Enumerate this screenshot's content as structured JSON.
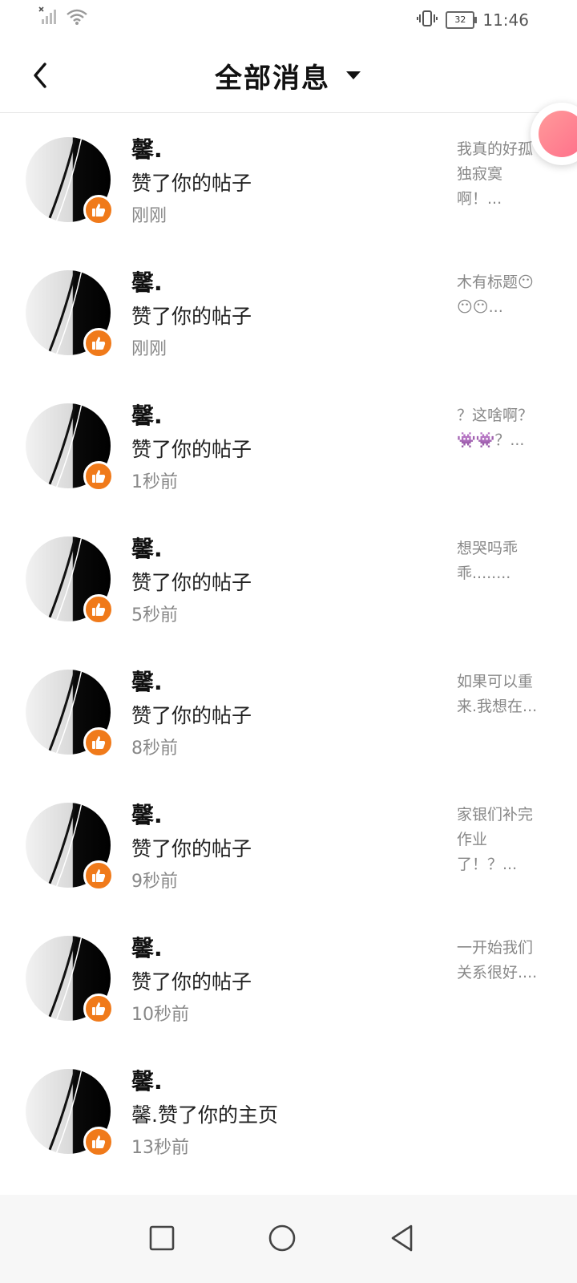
{
  "status_bar": {
    "time": "11:46",
    "battery": "32",
    "icons": [
      "signal-off-icon",
      "wifi-icon",
      "vibrate-icon",
      "battery-icon"
    ]
  },
  "header": {
    "title": "全部消息",
    "back_icon": "chevron-left-icon",
    "dropdown_icon": "caret-down-icon"
  },
  "messages": [
    {
      "user": "馨.",
      "action": "赞了你的帖子",
      "time": "刚刚",
      "preview": "我真的好孤独寂寞啊！..."
    },
    {
      "user": "馨.",
      "action": "赞了你的帖子",
      "time": "刚刚",
      "preview": "木有标题😶😶😶..."
    },
    {
      "user": "馨.",
      "action": "赞了你的帖子",
      "time": "1秒前",
      "preview": "？这啥啊？👾👾？..."
    },
    {
      "user": "馨.",
      "action": "赞了你的帖子",
      "time": "5秒前",
      "preview": "想哭吗乖乖........"
    },
    {
      "user": "馨.",
      "action": "赞了你的帖子",
      "time": "8秒前",
      "preview": "如果可以重来.我想在..."
    },
    {
      "user": "馨.",
      "action": "赞了你的帖子",
      "time": "9秒前",
      "preview": "家银们补完作业了！？..."
    },
    {
      "user": "馨.",
      "action": "赞了你的帖子",
      "time": "10秒前",
      "preview": "一开始我们关系很好...."
    },
    {
      "user": "馨.",
      "action": "馨.赞了你的主页",
      "time": "13秒前",
      "preview": ""
    }
  ],
  "colors": {
    "like_badge": "#f07a1a",
    "time_text": "#888888",
    "title_text": "#111111"
  },
  "nav_bar": {
    "icons": [
      "square-recent-apps-icon",
      "circle-home-icon",
      "triangle-back-icon"
    ]
  }
}
